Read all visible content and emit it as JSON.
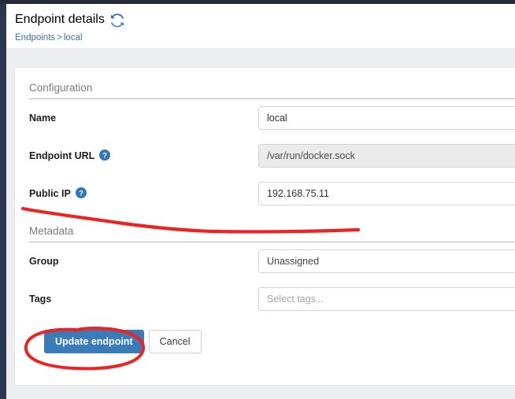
{
  "header": {
    "title": "Endpoint details",
    "refresh_icon": "refresh-icon",
    "breadcrumb": {
      "root": "Endpoints",
      "separator": ">",
      "current": "local"
    }
  },
  "panel": {
    "sections": [
      {
        "title": "Configuration",
        "rows": [
          {
            "label": "Name",
            "help_icon": null,
            "value": "local",
            "state": "editable"
          },
          {
            "label": "Endpoint URL",
            "help_icon": "help-icon",
            "value": "/var/run/docker.sock",
            "state": "readonly"
          },
          {
            "label": "Public IP",
            "help_icon": "help-icon",
            "value": "192.168.75.11",
            "state": "editable"
          }
        ]
      },
      {
        "title": "Metadata",
        "rows": [
          {
            "label": "Group",
            "help_icon": null,
            "value": "Unassigned",
            "state": "select"
          },
          {
            "label": "Tags",
            "help_icon": null,
            "value": "Select tags...",
            "state": "placeholder"
          }
        ]
      }
    ],
    "actions": {
      "submit": "Update endpoint",
      "cancel": "Cancel"
    }
  },
  "colors": {
    "accent_blue": "#3a7cb8",
    "link_blue": "#3f6fa5",
    "sidebar_navy": "#2d3650",
    "topbar_dark": "#232a3b",
    "page_bg": "#eceef0",
    "annotation_red": "#ee2222",
    "readonly_field_bg": "#ebebeb"
  },
  "annotations": [
    {
      "name": "underline-public-ip",
      "shape": "freehand-underline",
      "color": "#ee2222"
    },
    {
      "name": "ellipse-update-endpoint",
      "shape": "freehand-ellipse",
      "color": "#ee2222"
    }
  ]
}
